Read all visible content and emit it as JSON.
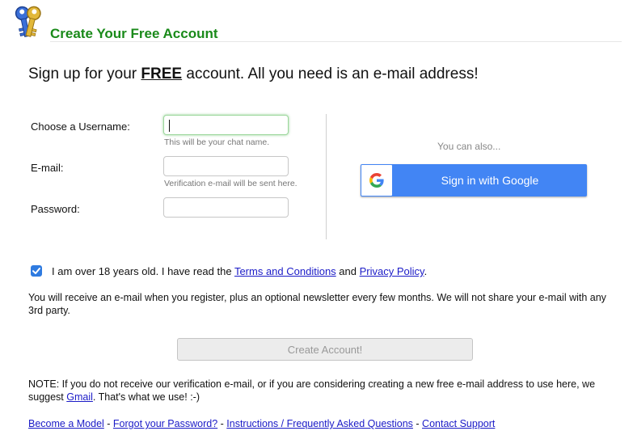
{
  "header": {
    "title": "Create Your Free Account"
  },
  "headline": {
    "before": "Sign up for your ",
    "emphasis": "FREE",
    "after": " account.  All you need is an e-mail address!"
  },
  "form": {
    "username": {
      "label": "Choose a Username:",
      "value": "",
      "hint": "This will be your chat name."
    },
    "email": {
      "label": "E-mail:",
      "value": "",
      "hint": "Verification e-mail will be sent here."
    },
    "password": {
      "label": "Password:",
      "value": ""
    }
  },
  "social": {
    "also_text": "You can also...",
    "google_label": "Sign in with Google",
    "google_icon": "google-g-icon"
  },
  "agreement": {
    "checked": true,
    "text_before": "I am over 18 years old. I have read the ",
    "terms_link": "Terms and Conditions",
    "text_middle": " and ",
    "privacy_link": "Privacy Policy",
    "text_after": "."
  },
  "notice": "You will receive an e-mail when you register, plus an optional newsletter every few months. We will not share your e-mail with any 3rd party.",
  "create_button": {
    "label": "Create Account!",
    "disabled": true
  },
  "note": {
    "before": "NOTE: If you do not receive our verification e-mail, or if you are considering creating a new free e-mail address to use here, we suggest ",
    "link": "Gmail",
    "after": ".  That's what we use! :-)"
  },
  "footer": {
    "links": [
      "Become a Model",
      "Forgot your Password?",
      "Instructions / Frequently Asked Questions",
      "Contact Support"
    ],
    "separator": " - "
  },
  "colors": {
    "title_green": "#1a8a1a",
    "link_blue": "#1b1bc7",
    "google_blue": "#4285f4",
    "checkbox_blue": "#2f7be0"
  }
}
